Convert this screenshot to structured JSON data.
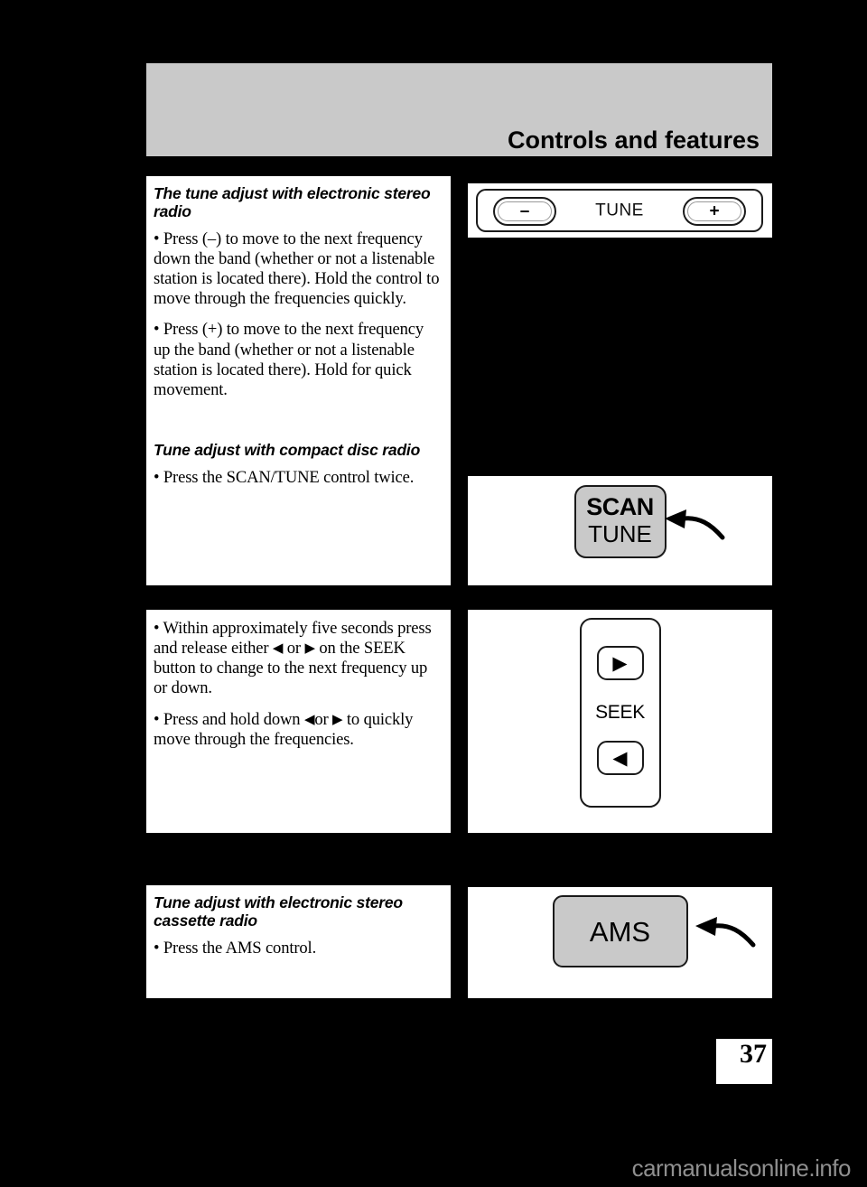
{
  "header": {
    "title": "Controls and features"
  },
  "sections": {
    "tune_electronic_stereo": {
      "heading": "The tune adjust with electronic stereo radio",
      "bullet_minus": "• Press (–) to move to the next frequency down the band (whether or not a listenable station is located there). Hold the control to move through the frequencies quickly.",
      "bullet_plus": "• Press (+) to move to the next frequency up the band (whether or not a listenable station is located there). Hold for quick movement."
    },
    "tune_compact_disc": {
      "heading": "Tune adjust with compact disc radio",
      "bullet": "• Press the SCAN/TUNE control twice."
    },
    "seek_instructions": {
      "bullet_one_pre": "• Within approximately five seconds press and release either ",
      "bullet_one_arrow_left": "◀",
      "bullet_one_mid": " or ",
      "bullet_one_arrow_right": "▶",
      "bullet_one_post": " on the SEEK button to change to the next frequency up or down.",
      "bullet_two_pre": "• Press and hold down ",
      "bullet_two_arrow_left": "◀",
      "bullet_two_mid": "or ",
      "bullet_two_arrow_right": "▶",
      "bullet_two_post": " to quickly move through the frequencies."
    },
    "tune_cassette": {
      "heading": "Tune adjust with electronic stereo cassette radio",
      "bullet": "• Press the AMS control."
    }
  },
  "illustrations": {
    "tune_rocker": {
      "minus_label": "–",
      "center_label": "TUNE",
      "plus_label": "+"
    },
    "scan_tune_button": {
      "line1": "SCAN",
      "line2": "TUNE",
      "callout_icon": "curved-arrow-left-icon"
    },
    "seek_panel": {
      "up_arrow": "▶",
      "label": "SEEK",
      "down_arrow": "◀"
    },
    "ams_button": {
      "label": "AMS",
      "callout_icon": "curved-arrow-left-icon"
    }
  },
  "footer": {
    "page_number": "37",
    "watermark": "carmanualsonline.info"
  },
  "colors": {
    "page_background": "#000000",
    "panel_background": "#ffffff",
    "header_bar": "#c9c9c9",
    "button_fill": "#c9c9c9",
    "outline": "#1a1a1a",
    "watermark": "#8f8f8f"
  }
}
